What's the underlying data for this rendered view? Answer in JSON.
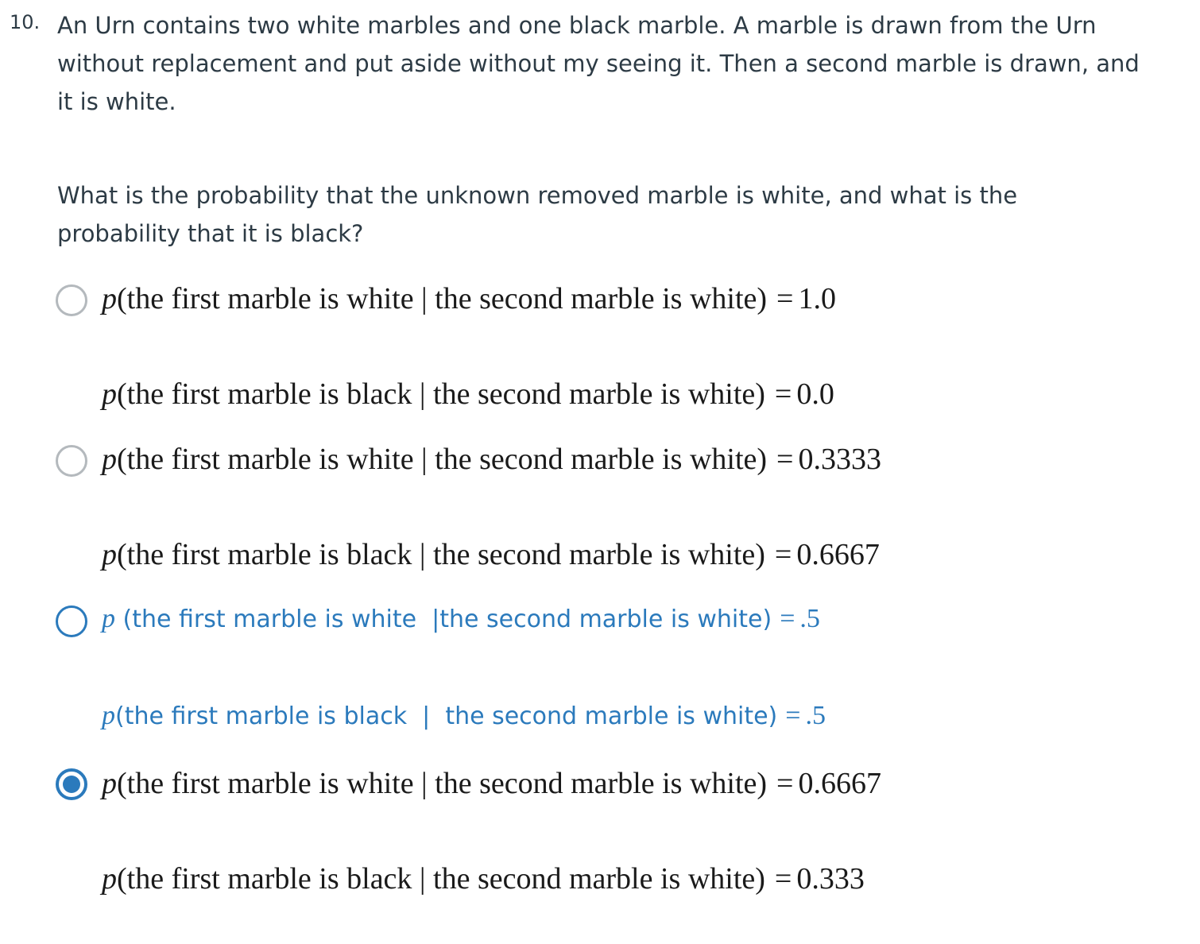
{
  "question": {
    "number": "10.",
    "stem_line1": "An Urn contains two white marbles and one black marble. A marble is drawn from the Urn",
    "stem_line2": "without replacement and put aside without my seeing it. Then a second marble is drawn, and",
    "stem_line3": "it is white.",
    "prompt_line1": "What is the probability that the unknown removed marble is white, and what is the",
    "prompt_line2": "probability that it is black?"
  },
  "options": [
    {
      "line1_p": "p",
      "line1_text": "(the first marble is white | the second marble is white)",
      "line1_eq": "=",
      "line1_value": "1.0",
      "line2_p": "p",
      "line2_text": "(the first marble is black | the second marble is white)",
      "line2_eq": "=",
      "line2_value": "0.0",
      "selected": false
    },
    {
      "line1_p": "p",
      "line1_text": "(the first marble is white | the second marble is white)",
      "line1_eq": "=",
      "line1_value": "0.3333",
      "line2_p": "p",
      "line2_text": "(the first marble is black | the second marble is white)",
      "line2_eq": "=",
      "line2_value": "0.6667",
      "selected": false
    },
    {
      "line1_p": "p",
      "line1_text": " (the first marble is white  |the second marble is white)",
      "line1_eq": "=",
      "line1_value": ".5",
      "line2_p": "p",
      "line2_text": "(the first marble is black  |  the second marble is white)",
      "line2_eq": "=",
      "line2_value": ".5",
      "selected": false,
      "hovered": true
    },
    {
      "line1_p": "p",
      "line1_text": "(the first marble is white | the second marble is white)",
      "line1_eq": "=",
      "line1_value": "0.6667",
      "line2_p": "p",
      "line2_text": "(the first marble is black | the second marble is white)",
      "line2_eq": "=",
      "line2_value": "0.333",
      "selected": true
    }
  ],
  "colors": {
    "text": "#2d3b45",
    "math": "#1a1a1a",
    "accent": "#2b7abc",
    "radio_border": "#b4b9bd"
  }
}
